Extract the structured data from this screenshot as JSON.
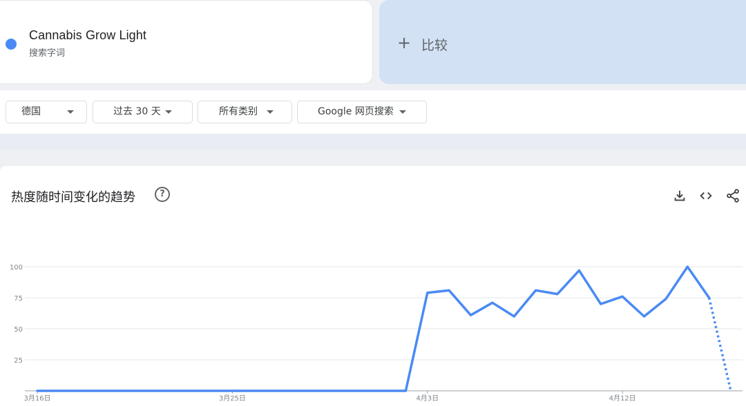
{
  "search_term": {
    "name": "Cannabis Grow Light",
    "type": "搜索字词",
    "color": "#4a8af4"
  },
  "compare": {
    "label": "比较",
    "icon": "plus-icon"
  },
  "filters": [
    {
      "label": "德国"
    },
    {
      "label": "过去 30 天"
    },
    {
      "label": "所有类别"
    },
    {
      "label": "Google 网页搜索"
    }
  ],
  "chart_section": {
    "title": "热度随时间变化的趋势",
    "help_icon": "help-circle-icon",
    "tools": [
      "download-icon",
      "embed-code-icon",
      "share-icon"
    ]
  },
  "chart_data": {
    "type": "line",
    "title": "",
    "xlabel": "",
    "ylabel": "",
    "ylim": [
      0,
      100
    ],
    "yticks": [
      25,
      50,
      75,
      100
    ],
    "grid": true,
    "x_tick_labels": [
      "3月16日",
      "3月25日",
      "4月3日",
      "4月12日"
    ],
    "x_tick_index": [
      0,
      9,
      18,
      27
    ],
    "series": [
      {
        "color": "#4a8af4",
        "values": [
          0,
          0,
          0,
          0,
          0,
          0,
          0,
          0,
          0,
          0,
          0,
          0,
          0,
          0,
          0,
          0,
          0,
          0,
          79,
          81,
          61,
          71,
          60,
          81,
          78,
          97,
          70,
          76,
          60,
          74,
          100,
          75,
          0
        ],
        "partial_from_index": 31
      }
    ]
  }
}
